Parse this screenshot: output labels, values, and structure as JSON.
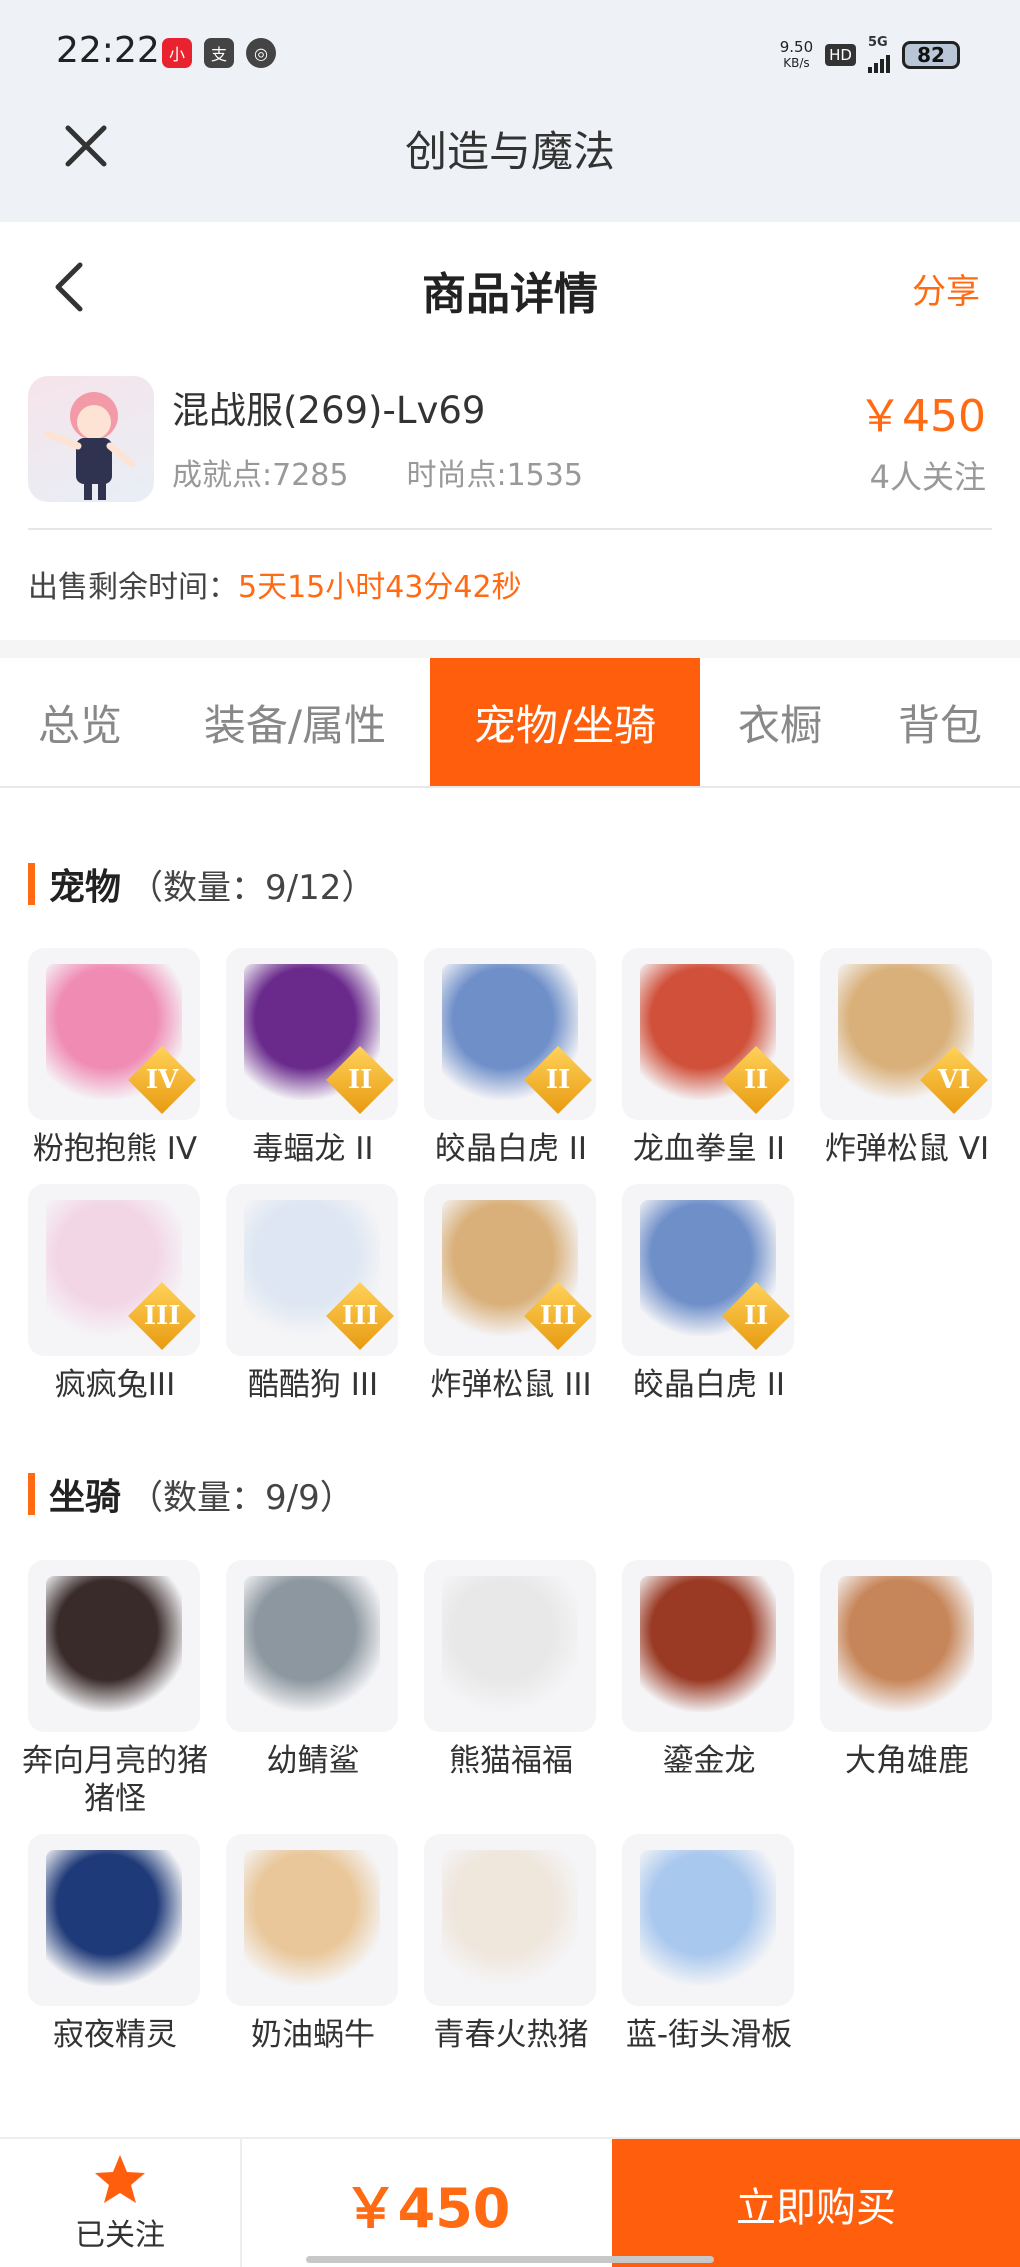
{
  "status_bar": {
    "time": "22:22",
    "net_speed_value": "9.50",
    "net_speed_unit": "KB/s",
    "hd_badge": "HD",
    "network": "5G",
    "battery": "82"
  },
  "app": {
    "title": "创造与魔法",
    "close_icon": "close-icon"
  },
  "page_header": {
    "title": "商品详情",
    "share_label": "分享"
  },
  "product": {
    "name": "混战服(269)-Lv69",
    "achievement": "成就点:7285",
    "fashion": "时尚点:1535",
    "price": "￥450",
    "followers": "4人关注",
    "time_left_label": "出售剩余时间：",
    "time_left_value": "5天15小时43分42秒"
  },
  "tabs": [
    {
      "label": "总览"
    },
    {
      "label": "装备/属性"
    },
    {
      "label": "宠物/坐骑"
    },
    {
      "label": "衣橱"
    },
    {
      "label": "背包"
    }
  ],
  "active_tab": "宠物/坐骑",
  "pets": {
    "title": "宠物",
    "count": "（数量：9/12）",
    "items": [
      {
        "label": "粉抱抱熊 IV",
        "tier": "IV",
        "color": "#f08cb4"
      },
      {
        "label": "毒蝠龙 II",
        "tier": "II",
        "color": "#6a2a8c"
      },
      {
        "label": "皎晶白虎 II",
        "tier": "II",
        "color": "#6f8fc9"
      },
      {
        "label": "龙血拳皇 II",
        "tier": "II",
        "color": "#d0503a"
      },
      {
        "label": "炸弹松鼠 VI",
        "tier": "VI",
        "color": "#d9b07a"
      },
      {
        "label": "疯疯兔III",
        "tier": "III",
        "color": "#f3d6e6"
      },
      {
        "label": "酷酷狗 III",
        "tier": "III",
        "color": "#dde6f2"
      },
      {
        "label": "炸弹松鼠 III",
        "tier": "III",
        "color": "#d9b07a"
      },
      {
        "label": "皎晶白虎 II",
        "tier": "II",
        "color": "#6f8fc9"
      }
    ]
  },
  "mounts": {
    "title": "坐骑",
    "count": "（数量：9/9）",
    "items": [
      {
        "label": "奔向月亮的猪猪怪",
        "color": "#3a2b2b"
      },
      {
        "label": "幼鲭鲨",
        "color": "#8c979f"
      },
      {
        "label": "熊猫福福",
        "color": "#e8e8e8"
      },
      {
        "label": "鎏金龙",
        "color": "#9a3a24"
      },
      {
        "label": "大角雄鹿",
        "color": "#c7865a"
      },
      {
        "label": "寂夜精灵",
        "color": "#1f3a78"
      },
      {
        "label": "奶油蜗牛",
        "color": "#e9c79a"
      },
      {
        "label": "青春火热猪",
        "color": "#efe6dc"
      },
      {
        "label": "蓝-街头滑板",
        "color": "#a9c8ee"
      }
    ]
  },
  "bottom_bar": {
    "follow_label": "已关注",
    "price": "￥450",
    "buy_label": "立即购买"
  }
}
